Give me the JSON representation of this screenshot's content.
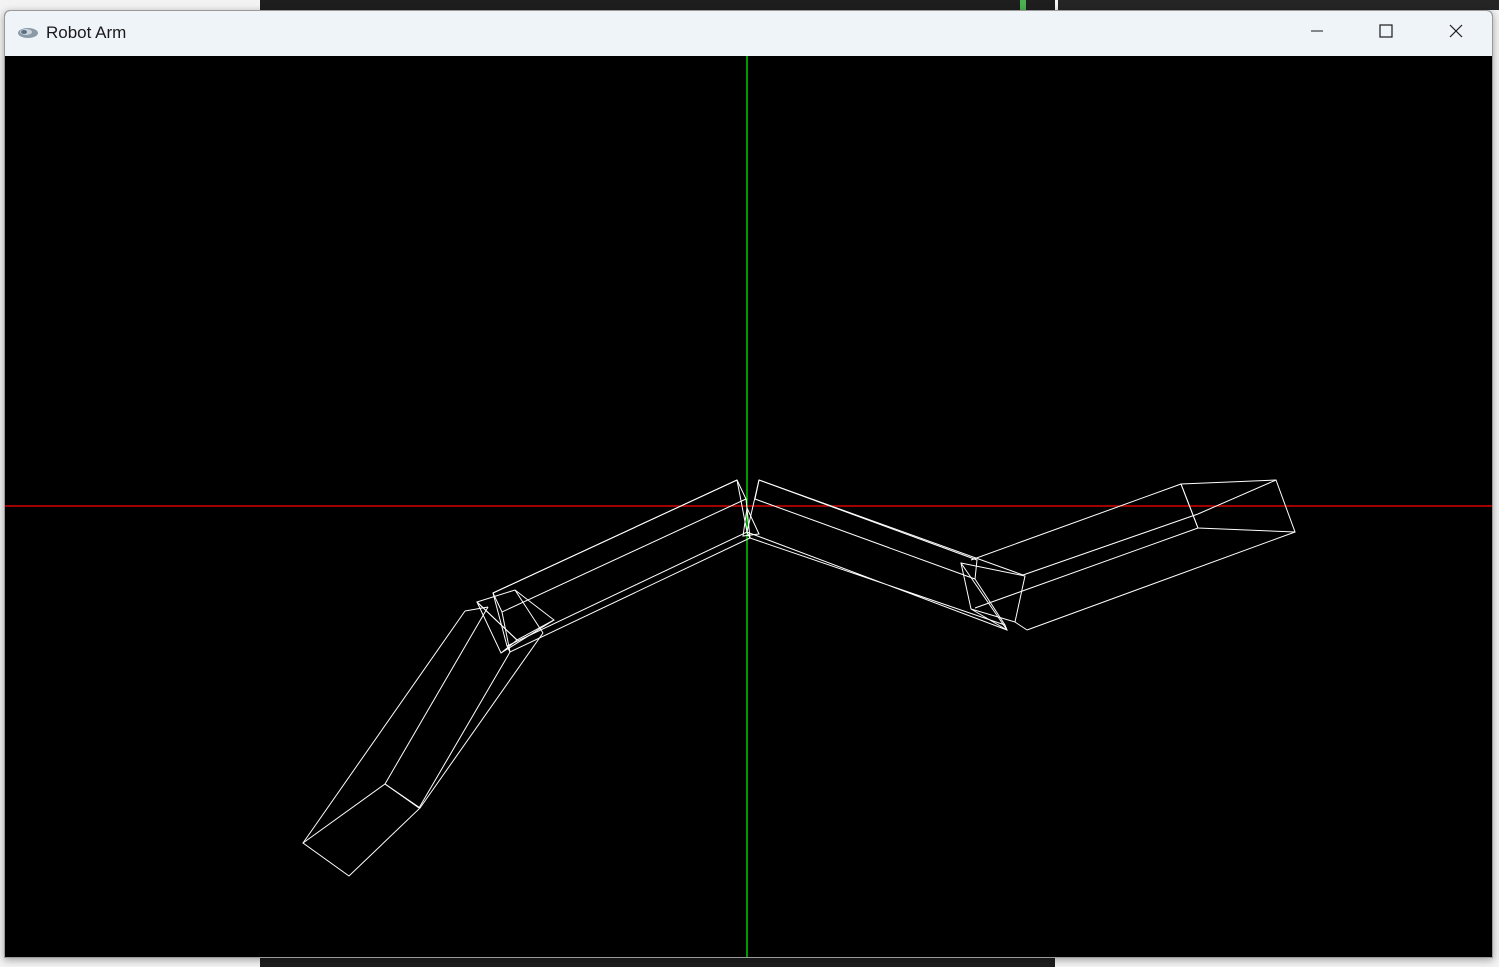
{
  "window": {
    "title": "Robot Arm",
    "icon": "opengl-app-icon"
  },
  "titlebar_buttons": {
    "minimize": "minimize-icon",
    "maximize": "maximize-icon",
    "close": "close-icon"
  },
  "viewport": {
    "background_color": "#000000",
    "x_axis_color": "#ff0000",
    "y_axis_color": "#00ff00",
    "wireframe_color": "#ffffff",
    "render_mode": "wireframe"
  }
}
